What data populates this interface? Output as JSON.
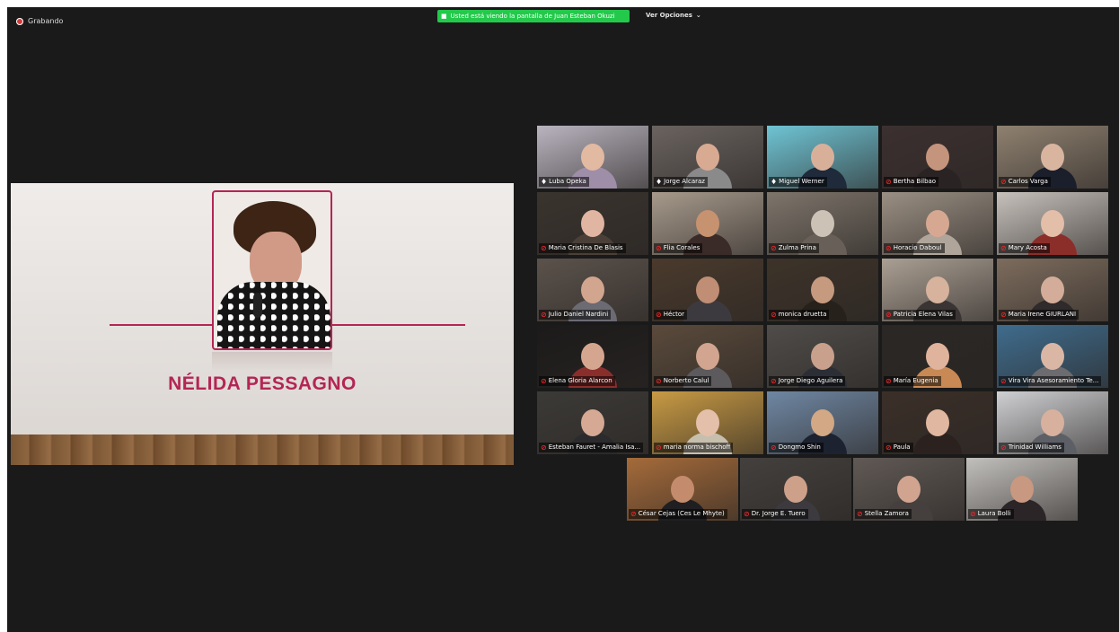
{
  "top": {
    "recording": "Grabando",
    "share_banner": "Usted está viendo la pantalla de Juan Esteban Okuzi",
    "view_options": "Ver Opciones"
  },
  "slide": {
    "name": "NÉLIDA PESSAGNO"
  },
  "participants": [
    {
      "name": "Luba Opeka",
      "muted": false,
      "bg": "#b9b4bf",
      "skin": "#e2b9a1",
      "shirt": "#9f8ea8"
    },
    {
      "name": "Jorge Alcaraz",
      "muted": false,
      "bg": "#6a6360",
      "skin": "#d8aa92",
      "shirt": "#8a8a8a"
    },
    {
      "name": "Miguel Werner",
      "muted": false,
      "active": true,
      "bg": "#6fc4d4",
      "skin": "#d8b09a",
      "shirt": "#1f2a3a"
    },
    {
      "name": "Bertha Bilbao",
      "muted": true,
      "bg": "#3c3030",
      "skin": "#c5947c",
      "shirt": "#2a2324"
    },
    {
      "name": "Carlos Varga",
      "muted": true,
      "bg": "#8f8170",
      "skin": "#d9b5a0",
      "shirt": "#1b1f2b"
    },
    {
      "name": "Maria Cristina De Blasis",
      "muted": true,
      "bg": "#3a342e",
      "skin": "#e0b5a2",
      "shirt": "#4a4038"
    },
    {
      "name": "Flia Corales",
      "muted": true,
      "bg": "#a79a8c",
      "skin": "#c79270",
      "shirt": "#3b2b28"
    },
    {
      "name": "Zulma Prina",
      "muted": true,
      "bg": "#7e756b",
      "skin": "#ccc2b6",
      "shirt": "#686058"
    },
    {
      "name": "Horacio Daboul",
      "muted": true,
      "bg": "#9a8f83",
      "skin": "#d6a892",
      "shirt": "#b0a59a"
    },
    {
      "name": "Mary Acosta",
      "muted": true,
      "bg": "#c6c1bb",
      "skin": "#e3bea8",
      "shirt": "#8b2e2a"
    },
    {
      "name": "Julio Daniel Nardini",
      "muted": true,
      "bg": "#5b524b",
      "skin": "#d2a58f",
      "shirt": "#6c6a73"
    },
    {
      "name": "Héctor",
      "muted": true,
      "bg": "#4a3a2c",
      "skin": "#bf8e74",
      "shirt": "#3d3a3f"
    },
    {
      "name": "monica druetta",
      "muted": true,
      "bg": "#3d3329",
      "skin": "#c69a7f",
      "shirt": "#27211c"
    },
    {
      "name": "Patricia Elena Vilas",
      "muted": true,
      "bg": "#aa9f93",
      "skin": "#d7b29c",
      "shirt": "#3a3534"
    },
    {
      "name": "Maria Irene GIURLANI",
      "muted": true,
      "bg": "#7d6c5d",
      "skin": "#d3ad99",
      "shirt": "#2f2a2c"
    },
    {
      "name": "Elena Gloria Alarcon",
      "muted": true,
      "bg": "#1c1a1a",
      "skin": "#d5a68f",
      "shirt": "#8a2e2c"
    },
    {
      "name": "Norberto Calul",
      "muted": true,
      "bg": "#5a4a3b",
      "skin": "#d1a58f",
      "shirt": "#5c5a5c"
    },
    {
      "name": "Jorge Diego Aguilera",
      "muted": true,
      "bg": "#4f4c49",
      "skin": "#c8a08c",
      "shirt": "#2c2e36"
    },
    {
      "name": "María  Eugenia",
      "muted": true,
      "bg": "#2b2724",
      "skin": "#e0b39c",
      "shirt": "#c88955"
    },
    {
      "name": "Vira Vira Asesoramiento Te...",
      "muted": true,
      "bg": "#3f6c8d",
      "skin": "#dab7a4",
      "shirt": "#6b6b70"
    },
    {
      "name": "Esteban Fauret - Amalia Isa...",
      "muted": true,
      "bg": "#3c3a36",
      "skin": "#d5a994",
      "shirt": "#2b2a2c"
    },
    {
      "name": "maria norma bischoff",
      "muted": true,
      "bg": "#c89a44",
      "skin": "#e4bfa9",
      "shirt": "#c7bfae"
    },
    {
      "name": "Dongmo Shin",
      "muted": true,
      "bg": "#6f87a3",
      "skin": "#d2a885",
      "shirt": "#1d2230"
    },
    {
      "name": "Paula",
      "muted": true,
      "bg": "#3b2f28",
      "skin": "#e0b7a0",
      "shirt": "#2b2220"
    },
    {
      "name": "Trinidad Williams",
      "muted": true,
      "bg": "#cfd0d3",
      "skin": "#d8b09e",
      "shirt": "#5d5f66"
    },
    {
      "name": "César Cejas (Ces Le Mhyte)",
      "muted": true,
      "bg": "#a56b3a",
      "skin": "#c48b6c",
      "shirt": "#1f1f22"
    },
    {
      "name": "Dr. Jorge E. Tuero",
      "muted": true,
      "bg": "#43403e",
      "skin": "#cda089",
      "shirt": "#3c3a3f"
    },
    {
      "name": "Stella Zamora",
      "muted": true,
      "bg": "#605955",
      "skin": "#d0a48f",
      "shirt": "#453f3e"
    },
    {
      "name": "Laura Bolli",
      "muted": true,
      "bg": "#c2c0bc",
      "skin": "#c89880",
      "shirt": "#2c2528"
    }
  ]
}
